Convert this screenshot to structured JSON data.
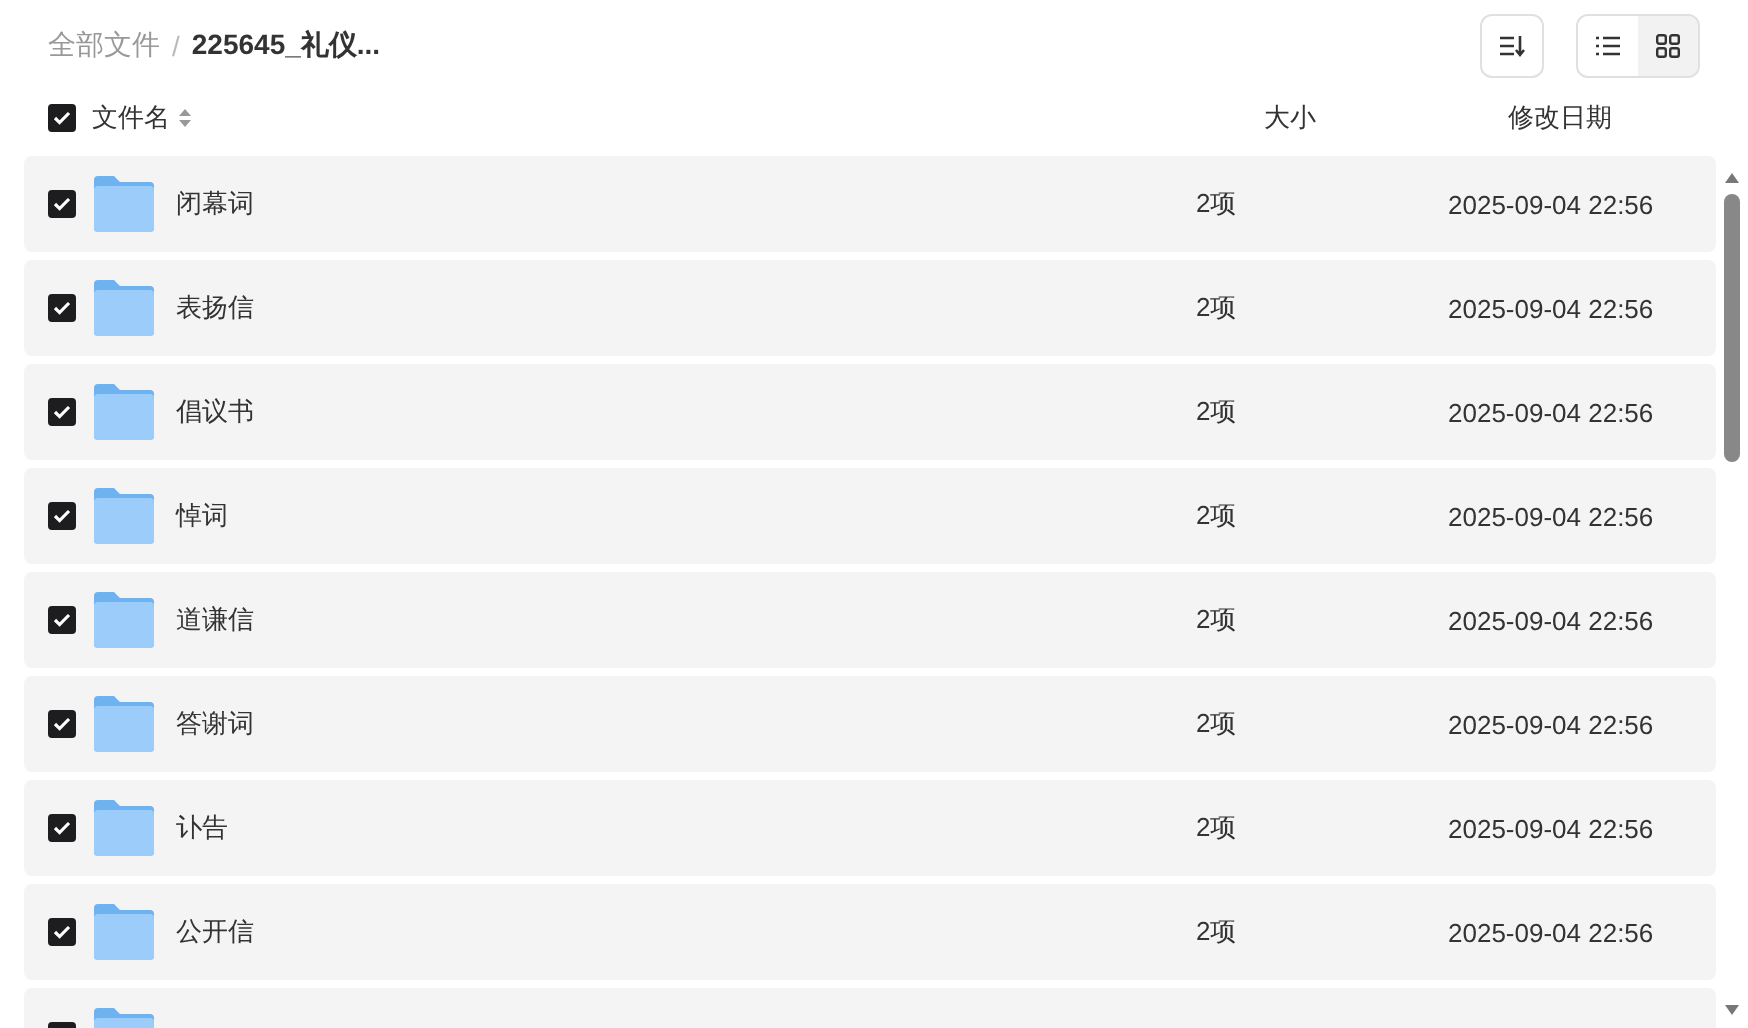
{
  "breadcrumb": {
    "items": [
      "全部文件",
      "225645_礼仪..."
    ],
    "separator": "/"
  },
  "toolbar": {
    "view_modes": [
      {
        "kind": "list",
        "selected": true
      },
      {
        "kind": "grid",
        "selected": false
      }
    ]
  },
  "header": {
    "all_checked": true,
    "columns": [
      "文件名",
      "大小",
      "修改日期"
    ]
  },
  "rows": [
    {
      "name": "闭幕词",
      "size": "2项",
      "modified": "2025-09-04 22:56",
      "checked": true
    },
    {
      "name": "表扬信",
      "size": "2项",
      "modified": "2025-09-04 22:56",
      "checked": true
    },
    {
      "name": "倡议书",
      "size": "2项",
      "modified": "2025-09-04 22:56",
      "checked": true
    },
    {
      "name": "悼词",
      "size": "2项",
      "modified": "2025-09-04 22:56",
      "checked": true
    },
    {
      "name": "道谦信",
      "size": "2项",
      "modified": "2025-09-04 22:56",
      "checked": true
    },
    {
      "name": "答谢词",
      "size": "2项",
      "modified": "2025-09-04 22:56",
      "checked": true
    },
    {
      "name": "讣告",
      "size": "2项",
      "modified": "2025-09-04 22:56",
      "checked": true
    },
    {
      "name": "公开信",
      "size": "2项",
      "modified": "2025-09-04 22:56",
      "checked": true
    },
    {
      "checked": true
    }
  ]
}
